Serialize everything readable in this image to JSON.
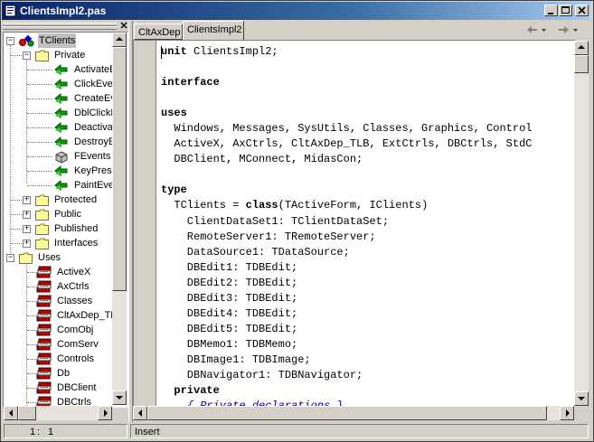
{
  "window": {
    "title": "ClientsImpl2.pas"
  },
  "tabs": [
    {
      "label": "CltAxDep",
      "active": false
    },
    {
      "label": "ClientsImpl2",
      "active": true
    }
  ],
  "tree": {
    "root": "TClients",
    "private_label": "Private",
    "private_items": [
      "ActivateE",
      "ClickEven",
      "CreateEv",
      "DblClickE",
      "Deactiva",
      "DestroyE",
      "FEvents",
      "KeyPress",
      "PaintEve"
    ],
    "folders": [
      "Protected",
      "Public",
      "Published",
      "Interfaces"
    ],
    "uses_label": "Uses",
    "uses_items": [
      "ActiveX",
      "AxCtrls",
      "Classes",
      "CltAxDep_TL",
      "ComObj",
      "ComServ",
      "Controls",
      "Db",
      "DBClient",
      "DBCtrls"
    ]
  },
  "code_lines": [
    {
      "t": "unit",
      "k": true,
      "rest": " ClientsImpl2;"
    },
    {
      "t": "",
      "k": false,
      "rest": ""
    },
    {
      "t": "interface",
      "k": true,
      "rest": ""
    },
    {
      "t": "",
      "k": false,
      "rest": ""
    },
    {
      "t": "uses",
      "k": true,
      "rest": ""
    },
    {
      "t": "",
      "k": false,
      "rest": "  Windows, Messages, SysUtils, Classes, Graphics, Control"
    },
    {
      "t": "",
      "k": false,
      "rest": "  ActiveX, AxCtrls, CltAxDep_TLB, ExtCtrls, DBCtrls, StdC"
    },
    {
      "t": "",
      "k": false,
      "rest": "  DBClient, MConnect, MidasCon;"
    },
    {
      "t": "",
      "k": false,
      "rest": ""
    },
    {
      "t": "type",
      "k": true,
      "rest": ""
    },
    {
      "t": "",
      "k": false,
      "rest": "  TClients = ",
      "kw2": "class",
      "rest2": "(TActiveForm, IClients)"
    },
    {
      "t": "",
      "k": false,
      "rest": "    ClientDataSet1: TClientDataSet;"
    },
    {
      "t": "",
      "k": false,
      "rest": "    RemoteServer1: TRemoteServer;"
    },
    {
      "t": "",
      "k": false,
      "rest": "    DataSource1: TDataSource;"
    },
    {
      "t": "",
      "k": false,
      "rest": "    DBEdit1: TDBEdit;"
    },
    {
      "t": "",
      "k": false,
      "rest": "    DBEdit2: TDBEdit;"
    },
    {
      "t": "",
      "k": false,
      "rest": "    DBEdit3: TDBEdit;"
    },
    {
      "t": "",
      "k": false,
      "rest": "    DBEdit4: TDBEdit;"
    },
    {
      "t": "",
      "k": false,
      "rest": "    DBEdit5: TDBEdit;"
    },
    {
      "t": "",
      "k": false,
      "rest": "    DBMemo1: TDBMemo;"
    },
    {
      "t": "",
      "k": false,
      "rest": "    DBImage1: TDBImage;"
    },
    {
      "t": "",
      "k": false,
      "rest": "    DBNavigator1: TDBNavigator;"
    },
    {
      "t": "",
      "k": false,
      "rest": "  ",
      "kw2": "private",
      "rest2": ""
    },
    {
      "t": "",
      "k": false,
      "rest": "",
      "comment": "    { Private declarations }"
    }
  ],
  "status": {
    "line": "1",
    "col": "1",
    "mode": "Insert"
  },
  "icons": {
    "app": "delphi-unit-icon",
    "folder": "folder-icon",
    "method": "green-method-icon",
    "field": "gray-field-icon",
    "unit": "unit-books-icon"
  }
}
